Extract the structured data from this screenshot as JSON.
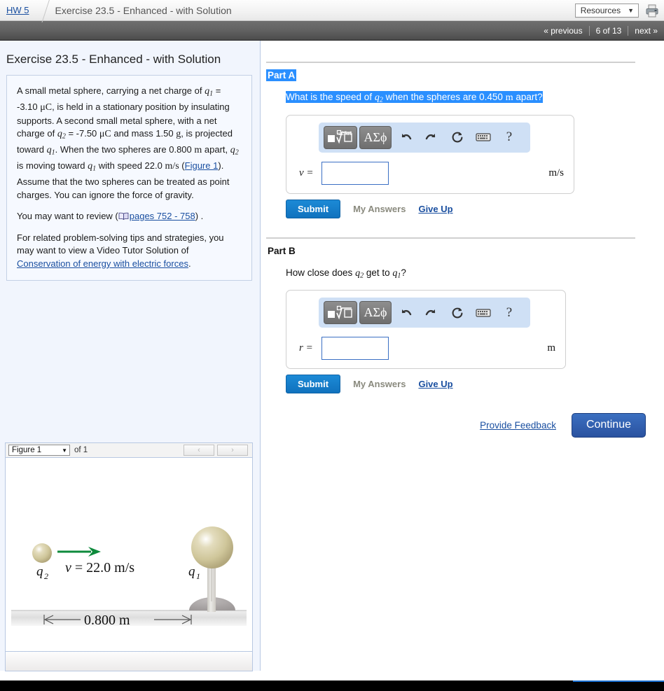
{
  "topbar": {
    "breadcrumb_home": "HW 5",
    "breadcrumb_title": "Exercise 23.5 - Enhanced - with Solution",
    "resources_label": "Resources",
    "resources_caret": "▼",
    "print_icon": "printer-icon"
  },
  "navbar": {
    "previous": "« previous",
    "page_count": "6 of 13",
    "next": "next »"
  },
  "left": {
    "exercise_title": "Exercise 23.5 - Enhanced - with Solution",
    "problem": {
      "line1_a": "A small metal sphere, carrying a net charge of ",
      "q1": "q",
      "q1_sub": "1",
      "line1_b": " = -3.10 ",
      "muC": "μC",
      "line2": ", is held in a stationary position by insulating supports. A second small metal sphere, with a net charge of ",
      "q2": "q",
      "q2_sub": "2",
      "line3": " = -7.50 ",
      "line4": " and mass 1.50 ",
      "gram": "g",
      "line5": ", is projected toward ",
      "line6": ". When the two spheres are 0.800 ",
      "meter": "m",
      "line7": " apart, ",
      "line8": " is moving toward ",
      "line9": " with speed 22.0 ",
      "ms": "m/s",
      "figure_link": "Figure 1",
      "line10": ". Assume that the two spheres can be treated as point charges. You can ignore the force of gravity."
    },
    "review_prefix": "You may want to review (",
    "review_link": "pages 752 - 758",
    "review_suffix": ") .",
    "tips_prefix": "For related problem-solving tips and strategies, you may want to view a Video Tutor Solution of ",
    "tips_link": "Conservation of energy with electric forces",
    "tips_suffix": "."
  },
  "figure_panel": {
    "select_value": "Figure 1",
    "select_caret": "▼",
    "of_label": "of 1",
    "prev_arrow": "‹",
    "next_arrow": "›",
    "labels": {
      "q2": "q",
      "q2_sub": "2",
      "q1": "q",
      "q1_sub": "1",
      "velocity": "v = 22.0 m/s",
      "distance": "0.800 m"
    },
    "colors": {
      "sphere": "#cfc69a",
      "arrow": "#0e8a3c",
      "ground": "#d9d9d9",
      "base": "#a9a5a5"
    }
  },
  "parts": [
    {
      "label": "Part A",
      "label_selected": true,
      "question_segments": [
        {
          "text": "What is the speed of ",
          "hl": true
        },
        {
          "text": "q",
          "sub": "2",
          "hl": true
        },
        {
          "text": " when the spheres are 0.450 ",
          "hl": true
        },
        {
          "text": "m",
          "hl": true
        },
        {
          "text": " apart?",
          "hl": true
        }
      ],
      "question_plain": "What is the speed of q2 when the spheres are 0.450 m apart?",
      "answer_symbol": "v =",
      "answer_value": "",
      "unit": "m/s",
      "submit_label": "Submit",
      "my_answers_label": "My Answers",
      "give_up_label": "Give Up"
    },
    {
      "label": "Part B",
      "label_selected": false,
      "question_plain": "How close does q2 get to q1?",
      "question_pre": "How close does ",
      "question_mid": " get to ",
      "question_post": "?",
      "answer_symbol": "r =",
      "answer_value": "",
      "unit": "m",
      "submit_label": "Submit",
      "my_answers_label": "My Answers",
      "give_up_label": "Give Up"
    }
  ],
  "mathbar": {
    "template_btn": "template-root-icon",
    "greek_btn": "ΑΣϕ",
    "undo_icon": "undo-arrow-icon",
    "redo_icon": "redo-arrow-icon",
    "reset_icon": "reset-circular-arrow-icon",
    "keyboard_icon": "keyboard-icon",
    "help_label": "?"
  },
  "footer": {
    "provide_feedback": "Provide Feedback",
    "continue_label": "Continue"
  },
  "colors": {
    "selection_blue": "#2a8fff",
    "link_blue": "#1a4fa0",
    "submit_blue": "#1072be",
    "continue_blue": "#2a52a0",
    "panel_bg": "#f1f5fd"
  }
}
